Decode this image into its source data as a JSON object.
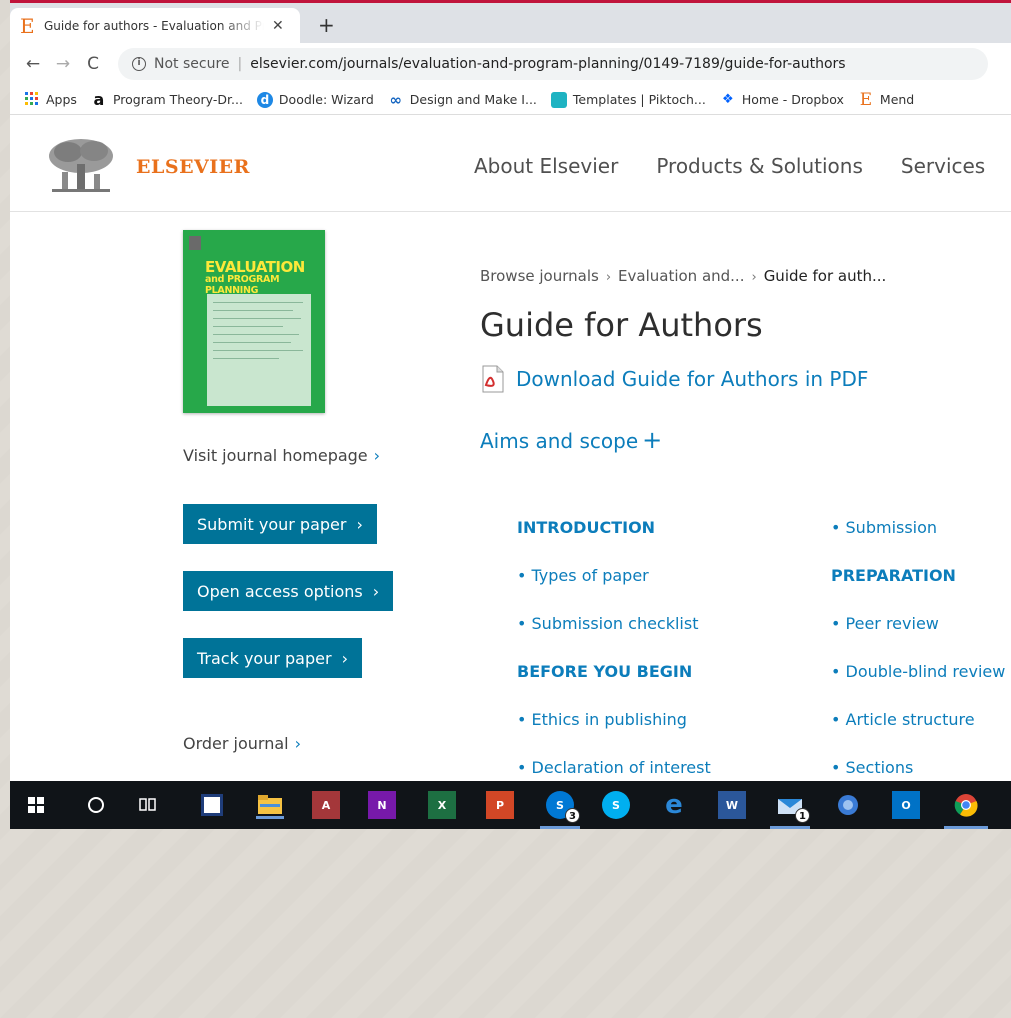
{
  "colors": {
    "accent_red": "#c0143c",
    "elsevier_orange": "#e9711c",
    "link_blue": "#0c7dbb",
    "button_blue": "#007398",
    "cover_green": "#27a84a",
    "cover_yellow": "#fce83a"
  },
  "browser": {
    "tab": {
      "title": "Guide for authors - Evaluation and Program Planning - ISSN",
      "favicon": "E",
      "close": "✕"
    },
    "new_tab": "+",
    "nav": {
      "back": "←",
      "forward": "→",
      "reload": "C"
    },
    "address": {
      "security_label": "Not secure",
      "url": "elsevier.com/journals/evaluation-and-program-planning/0149-7189/guide-for-authors"
    },
    "bookmarks": [
      {
        "label": "Apps",
        "icon": "apps-grid-icon"
      },
      {
        "label": "Program Theory-Dr...",
        "icon": "amazon-icon"
      },
      {
        "label": "Doodle: Wizard",
        "icon": "doodle-icon"
      },
      {
        "label": "Design and Make I...",
        "icon": "infinity-icon"
      },
      {
        "label": "Templates | Piktoch...",
        "icon": "piktochart-icon"
      },
      {
        "label": "Home - Dropbox",
        "icon": "dropbox-icon"
      },
      {
        "label": "Mend",
        "icon": "elsevier-e-icon"
      }
    ]
  },
  "site": {
    "logo": "ELSEVIER",
    "nav": [
      "About Elsevier",
      "Products & Solutions",
      "Services",
      "S"
    ]
  },
  "cover": {
    "title_line1": "EVALUATION",
    "title_line2": "and PROGRAM PLANNING"
  },
  "sidebar": {
    "visit_homepage": "Visit journal homepage",
    "submit": "Submit your paper",
    "open_access": "Open access options",
    "track": "Track your paper",
    "order": "Order journal",
    "chevron": "›"
  },
  "breadcrumb": {
    "items": [
      "Browse journals",
      "Evaluation and...",
      "Guide for auth..."
    ],
    "separator": "›"
  },
  "main": {
    "title": "Guide for Authors",
    "download_pdf": "Download Guide for Authors in PDF",
    "aims_scope": "Aims and scope",
    "aims_plus": "+"
  },
  "toc": {
    "col1": [
      {
        "text": "INTRODUCTION",
        "heading": true
      },
      {
        "text": "• Types of paper",
        "heading": false
      },
      {
        "text": "• Submission checklist",
        "heading": false
      },
      {
        "text": "BEFORE YOU BEGIN",
        "heading": true
      },
      {
        "text": "• Ethics in publishing",
        "heading": false
      },
      {
        "text": "• Declaration of interest",
        "heading": false
      }
    ],
    "col2": [
      {
        "text": "• Submission",
        "heading": false
      },
      {
        "text": "PREPARATION",
        "heading": true
      },
      {
        "text": "• Peer review",
        "heading": false
      },
      {
        "text": "• Double-blind review",
        "heading": false
      },
      {
        "text": "• Article structure",
        "heading": false
      },
      {
        "text": "• Sections",
        "heading": false
      }
    ]
  },
  "taskbar": {
    "badges": {
      "skype_business": "3",
      "mail": "1"
    },
    "apps": [
      "windows-start-icon",
      "cortana-icon",
      "task-view-icon",
      "app-icon",
      "file-explorer-icon",
      "access-icon",
      "onenote-icon",
      "excel-icon",
      "powerpoint-icon",
      "skype-business-icon",
      "skype-icon",
      "edge-icon",
      "word-icon",
      "mail-icon",
      "network-icon",
      "outlook-icon",
      "chrome-icon"
    ],
    "labels": {
      "access": "A",
      "onenote": "N",
      "excel": "X",
      "powerpoint": "P",
      "skype_business": "S",
      "skype": "S",
      "edge": "e",
      "word": "W",
      "outlook": "O"
    }
  }
}
